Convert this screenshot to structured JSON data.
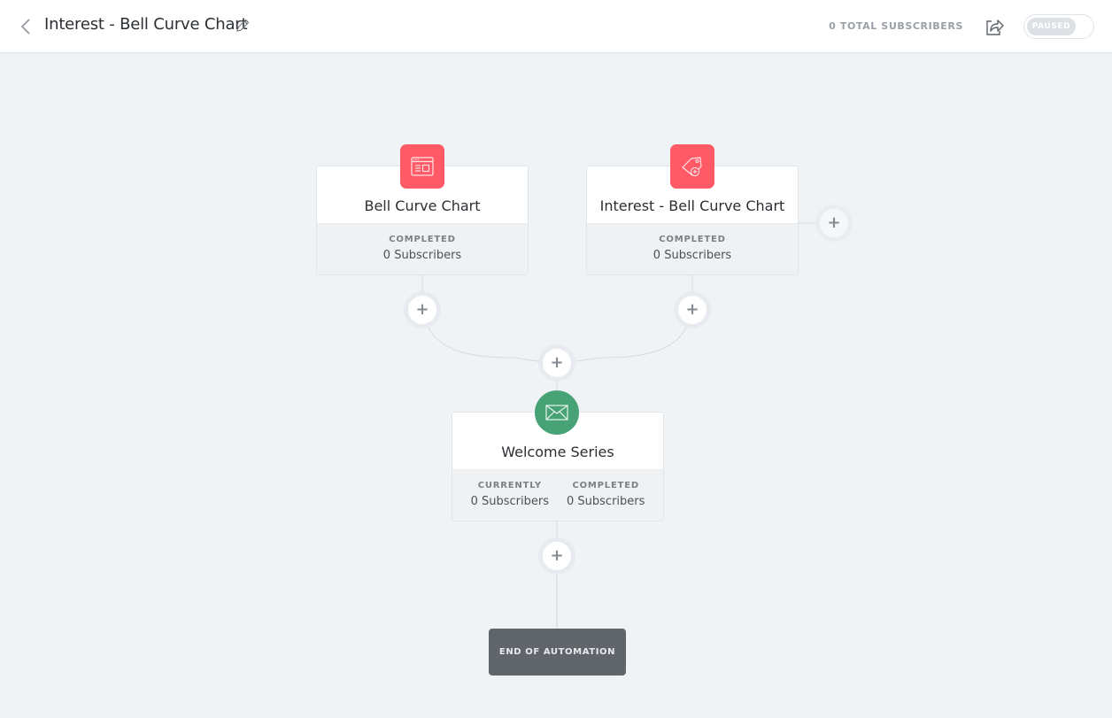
{
  "header": {
    "title": "Interest - Bell Curve Chart",
    "total_subscribers": "0 TOTAL SUBSCRIBERS",
    "status_toggle_label": "PAUSED",
    "icons": {
      "back": "chevron-left-icon",
      "edit": "pencil-icon",
      "share": "share-icon"
    }
  },
  "workflow": {
    "triggers": [
      {
        "title": "Bell Curve Chart",
        "icon": "form-icon",
        "icon_color": "#ff5a66",
        "stats": [
          {
            "label": "COMPLETED",
            "value": "0 Subscribers"
          }
        ]
      },
      {
        "title": "Interest - Bell Curve Chart",
        "icon": "tag-add-icon",
        "icon_color": "#ff5a66",
        "stats": [
          {
            "label": "COMPLETED",
            "value": "0 Subscribers"
          }
        ]
      }
    ],
    "action": {
      "title": "Welcome Series",
      "icon": "envelope-icon",
      "icon_color": "#47a276",
      "stats": [
        {
          "label": "CURRENTLY",
          "value": "0 Subscribers"
        },
        {
          "label": "COMPLETED",
          "value": "0 Subscribers"
        }
      ]
    },
    "add_step_symbol": "+",
    "end_label": "END OF AUTOMATION"
  }
}
